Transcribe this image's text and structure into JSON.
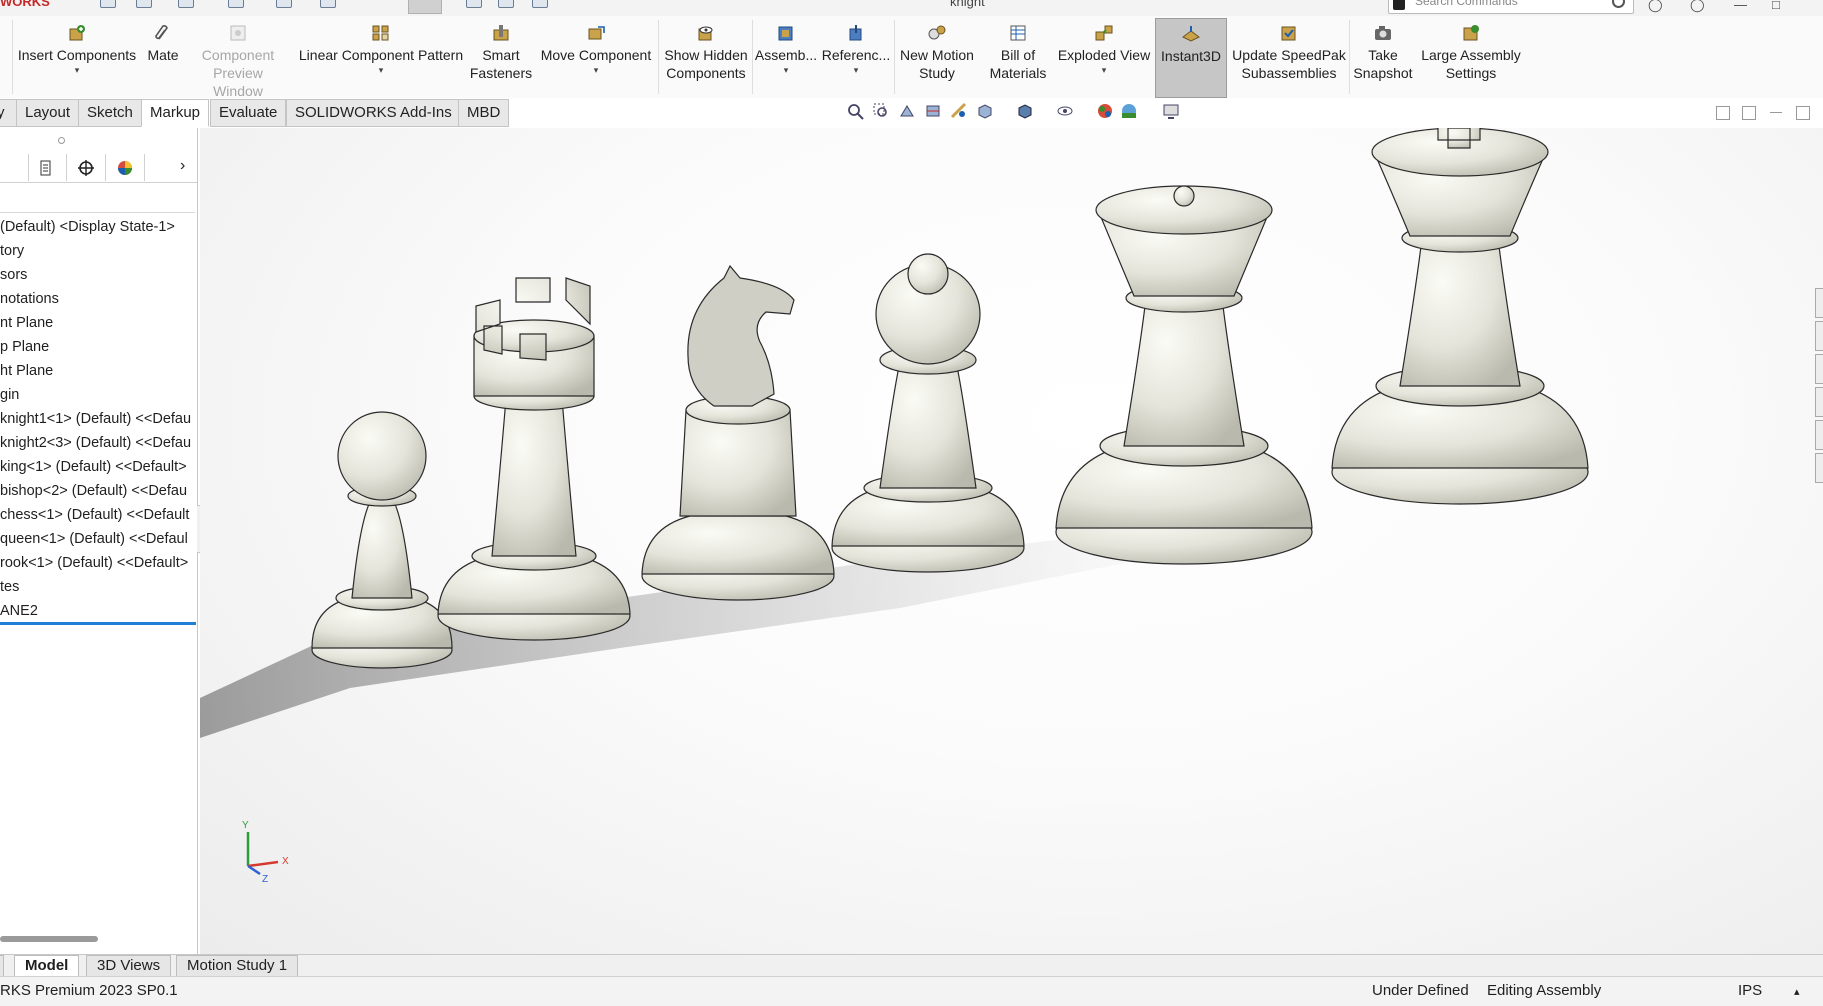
{
  "title_bar": {
    "brand": "WORKS",
    "document_title": "knight",
    "search_placeholder": "Search Commands"
  },
  "commands": [
    {
      "id": "insert-components",
      "label": "Insert Components",
      "has_dropdown": true
    },
    {
      "id": "mate",
      "label": "Mate"
    },
    {
      "id": "component-preview-window",
      "label": "Component\nPreview Window",
      "disabled": true
    },
    {
      "id": "linear-component-pattern",
      "label": "Linear Component Pattern",
      "has_dropdown": true
    },
    {
      "id": "smart-fasteners",
      "label": "Smart\nFasteners"
    },
    {
      "id": "move-component",
      "label": "Move Component",
      "has_dropdown": true
    },
    {
      "id": "show-hidden-components",
      "label": "Show Hidden\nComponents"
    },
    {
      "id": "assembly",
      "label": "Assemb...",
      "has_dropdown": true
    },
    {
      "id": "reference",
      "label": "Referenc...",
      "has_dropdown": true
    },
    {
      "id": "new-motion-study",
      "label": "New Motion\nStudy"
    },
    {
      "id": "bill-of-materials",
      "label": "Bill of\nMaterials"
    },
    {
      "id": "exploded-view",
      "label": "Exploded View",
      "has_dropdown": true
    },
    {
      "id": "instant3d",
      "label": "Instant3D",
      "active": true
    },
    {
      "id": "update-speedpak",
      "label": "Update SpeedPak\nSubassemblies"
    },
    {
      "id": "take-snapshot",
      "label": "Take\nSnapshot"
    },
    {
      "id": "large-assembly-settings",
      "label": "Large Assembly\nSettings"
    }
  ],
  "tabs": [
    "y",
    "Layout",
    "Sketch",
    "Markup",
    "Evaluate",
    "SOLIDWORKS Add-Ins",
    "MBD"
  ],
  "active_tab": "Markup",
  "feature_tree": [
    "(Default) <Display State-1>",
    "tory",
    "sors",
    "notations",
    "nt Plane",
    "p Plane",
    "ht Plane",
    "gin",
    "knight1<1> (Default) <<Defau",
    "knight2<3> (Default) <<Defau",
    "king<1> (Default) <<Default>",
    "bishop<2> (Default) <<Defau",
    "chess<1> (Default) <<Default",
    "queen<1> (Default) <<Defaul",
    "rook<1> (Default) <<Default>",
    "tes",
    "ANE2"
  ],
  "triad": {
    "x": "X",
    "y": "Y",
    "z": "Z"
  },
  "bottom_tabs": [
    "Model",
    "3D Views",
    "Motion Study 1"
  ],
  "active_bottom_tab": "Model",
  "status": {
    "product": "RKS Premium 2023 SP0.1",
    "definition": "Under Defined",
    "mode": "Editing Assembly",
    "units": "IPS"
  },
  "colors": {
    "piece_fill": "#e9e9e1",
    "piece_shadow": "#c9c9bf",
    "rollback_bar": "#1f7fd4",
    "brand": "#c62828"
  }
}
